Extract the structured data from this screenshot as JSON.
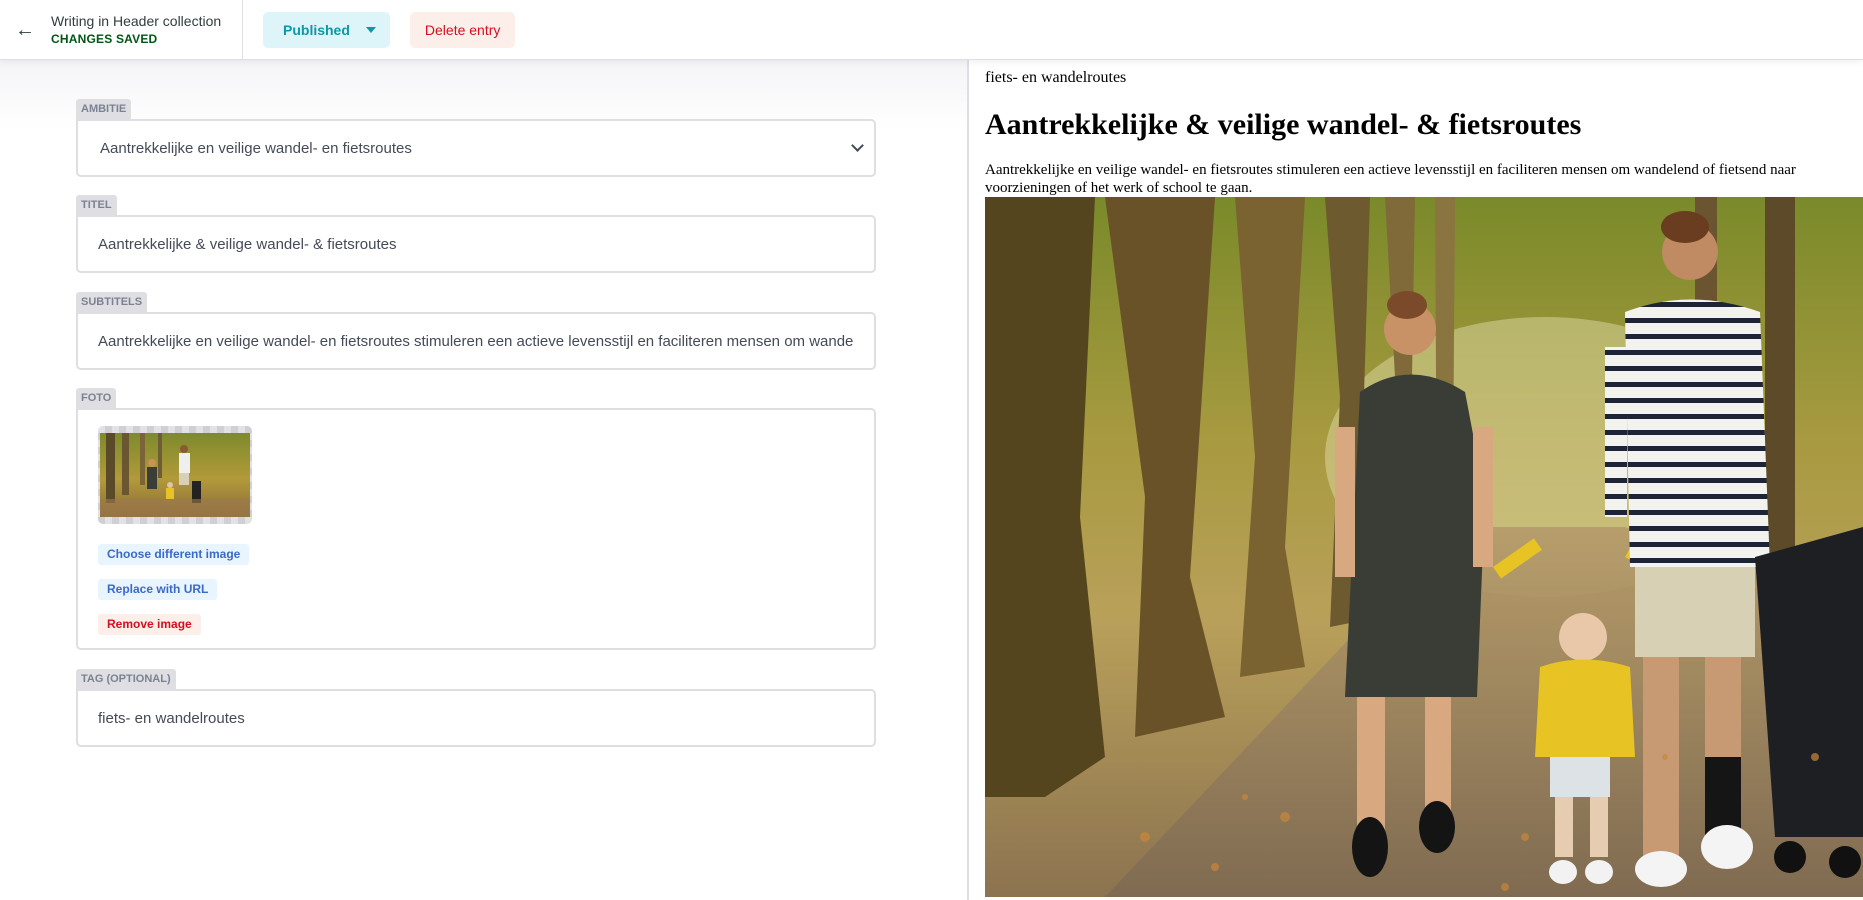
{
  "header": {
    "back_icon": "arrow-left-icon",
    "collection_title": "Writing in Header collection",
    "save_status": "CHANGES SAVED",
    "status_button": "Published",
    "delete_button": "Delete entry"
  },
  "fields": {
    "ambitie": {
      "label": "AMBITIE",
      "value": "Aantrekkelijke en veilige wandel- en fietsroutes"
    },
    "titel": {
      "label": "TITEL",
      "value": "Aantrekkelijke & veilige wandel- & fietsroutes"
    },
    "subtitels": {
      "label": "SUBTITELS",
      "value": "Aantrekkelijke en veilige wandel- en fietsroutes stimuleren een actieve levensstijl en faciliteren mensen om wande"
    },
    "foto": {
      "label": "FOTO",
      "choose_button": "Choose different image",
      "replace_button": "Replace with URL",
      "remove_button": "Remove image"
    },
    "tag": {
      "label": "TAG (OPTIONAL)",
      "value": "fiets- en wandelroutes"
    }
  },
  "preview": {
    "tag": "fiets- en wandelroutes",
    "title": "Aantrekkelijke & veilige wandel- & fietsroutes",
    "subtitle": "Aantrekkelijke en veilige wandel- en fietsroutes stimuleren een actieve levensstijl en faciliteren mensen om wandelend of fietsend naar voorzieningen of het werk of school te gaan."
  },
  "colors": {
    "saved_green": "#005614",
    "published_teal": "#1195aa",
    "delete_red": "#d50f1f",
    "link_blue": "#3a69c7"
  }
}
